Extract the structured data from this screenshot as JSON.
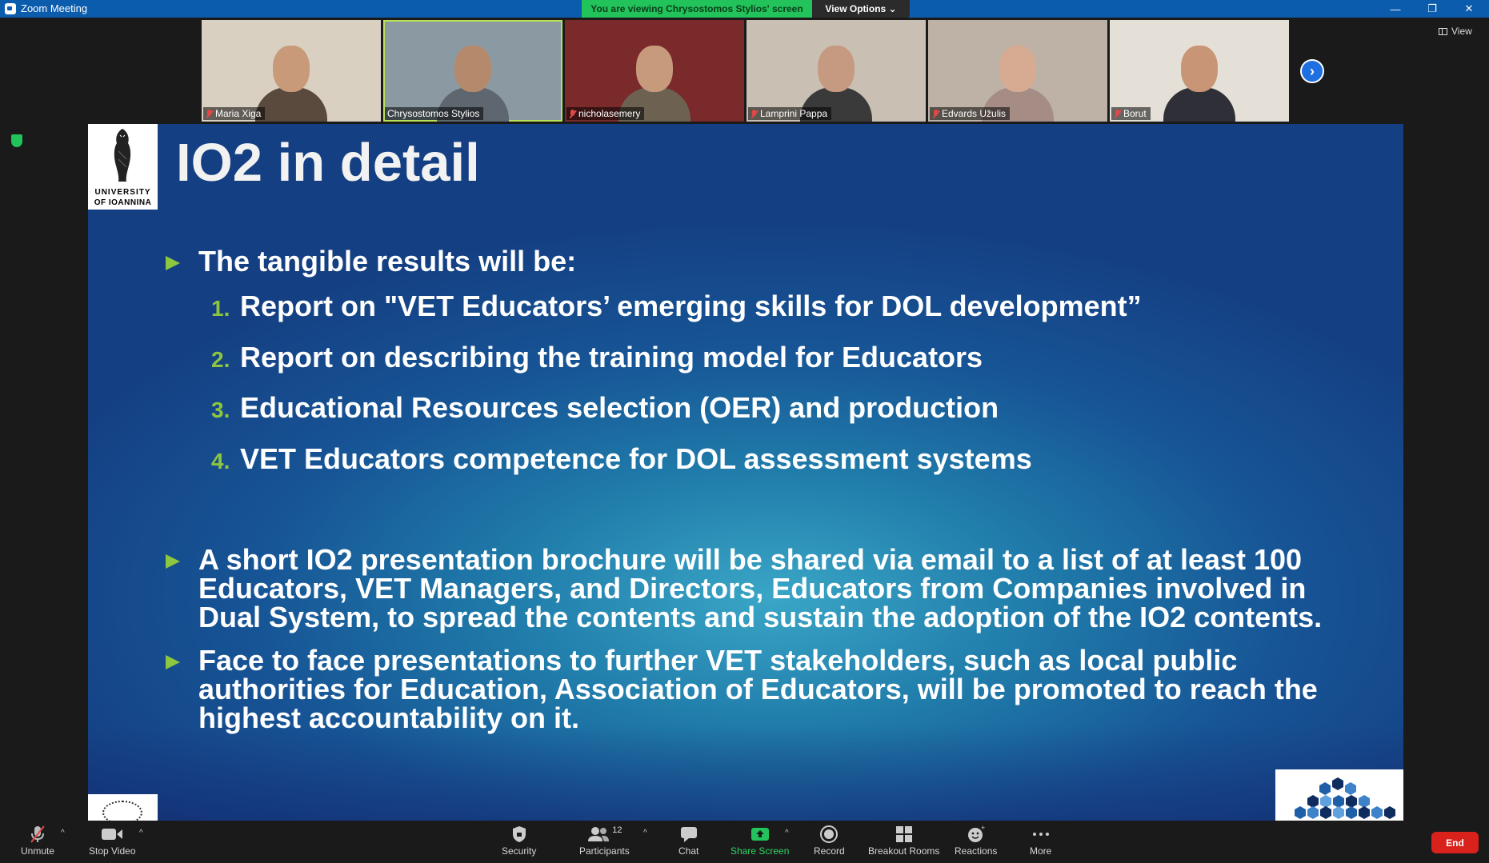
{
  "window": {
    "title": "Zoom Meeting",
    "minimize": "—",
    "restore": "❐",
    "close": "✕"
  },
  "banner": {
    "viewing": "You are viewing Chrysostomos Stylios' screen",
    "view_options": "View Options ⌄",
    "view": "View"
  },
  "participants_strip": [
    {
      "name": "Maria Xiga",
      "muted": true,
      "bg": "#d9d0c2",
      "skin": "#c99a7a",
      "shirt": "#5a4a3e"
    },
    {
      "name": "Chrysostomos Stylios",
      "muted": false,
      "bg": "#8b9aa2",
      "skin": "#b5896c",
      "shirt": "#5e6670",
      "active": true
    },
    {
      "name": "nicholasemery",
      "muted": true,
      "bg": "#7a2a2a",
      "skin": "#c79a7c",
      "shirt": "#6d6152"
    },
    {
      "name": "Lamprini Pappa",
      "muted": true,
      "bg": "#c9c0b3",
      "skin": "#c59a80",
      "shirt": "#3a3a3a"
    },
    {
      "name": "Edvards Užulis",
      "muted": true,
      "bg": "#bdb2a5",
      "skin": "#d6ab92",
      "shirt": "#a58d86"
    },
    {
      "name": "Borut",
      "muted": true,
      "bg": "#e4e0d8",
      "skin": "#c89676",
      "shirt": "#2f2f38"
    }
  ],
  "slide": {
    "logo_line1": "UNIVERSITY",
    "logo_line2": "OF IOANNINA",
    "title": "IO2 in detail",
    "intro": "The tangible results will be:",
    "items": [
      {
        "num": "1.",
        "text": "Report on \"VET Educators’ emerging skills for DOL development”"
      },
      {
        "num": "2.",
        "text": "Report on describing the training model for Educators"
      },
      {
        "num": "3.",
        "text": "Educational Resources selection (OER) and production"
      },
      {
        "num": "4.",
        "text": "VET Educators competence for DOL assessment systems"
      }
    ],
    "bullet2_lines": [
      "A short IO2 presentation brochure will be shared via email to a list of at least 100",
      "Educators, VET Managers, and Directors, Educators from Companies involved in",
      "Dual System, to spread the contents and sustain the adoption of the IO2 contents."
    ],
    "bullet3_lines": [
      "Face to face presentations to further VET stakeholders, such as local public",
      "authorities for Education, Association of Educators, will be promoted to reach the",
      "highest accountability on it."
    ]
  },
  "toolbar": {
    "unmute": "Unmute",
    "stop_video": "Stop Video",
    "security": "Security",
    "participants": "Participants",
    "participants_count": "12",
    "chat": "Chat",
    "share_screen": "Share Screen",
    "record": "Record",
    "breakout_rooms": "Breakout Rooms",
    "reactions": "Reactions",
    "more": "More",
    "end": "End"
  },
  "colors": {
    "titlebar": "#0b5cad",
    "banner_green": "#21c35a",
    "bullet_green": "#8dc63f",
    "end_red": "#d9221c"
  }
}
